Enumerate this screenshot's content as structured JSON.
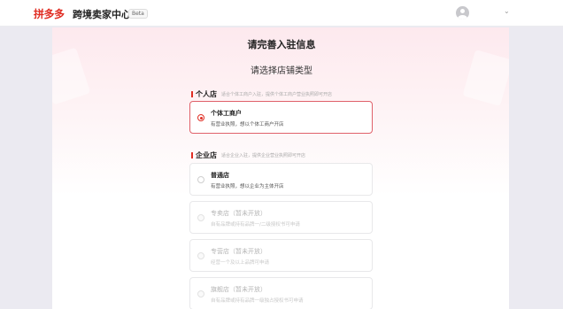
{
  "header": {
    "logo": "拼多多",
    "brand": "跨境卖家中心",
    "badge": "Beta",
    "chevron": "⌄",
    "icons": {
      "avatar": "user-avatar-icon",
      "dropdown": "chevron-down-icon"
    }
  },
  "page": {
    "title": "请完善入驻信息",
    "subtitle": "请选择店铺类型"
  },
  "sections": {
    "personal": {
      "name": "个人店",
      "desc": "适合个体工商户入驻，提供个体工商户营业执照即可开店"
    },
    "enterprise": {
      "name": "企业店",
      "desc": "适合企业入驻，提供企业营业执照即可开店"
    }
  },
  "options": {
    "individual": {
      "title": "个体工商户",
      "desc": "有营业执照，想以个体工商户开店",
      "selected": true
    },
    "ordinary": {
      "title": "普通店",
      "desc": "有营业执照，想以企业为主体开店",
      "selected": false
    },
    "specialty": {
      "title": "专卖店（暂未开放）",
      "desc": "自有品牌或持有品牌一/二级授权书可申请",
      "disabled": true
    },
    "franchise": {
      "title": "专营店（暂未开放）",
      "desc": "经营一个及以上品牌可申请",
      "disabled": true
    },
    "flagship": {
      "title": "旗舰店（暂未开放）",
      "desc": "自有品牌或持有品牌一级独占授权书可申请",
      "disabled": true
    }
  },
  "colors": {
    "brand": "#e02e24",
    "panel_top": "#fde9ee",
    "background": "#ebeaf1"
  }
}
